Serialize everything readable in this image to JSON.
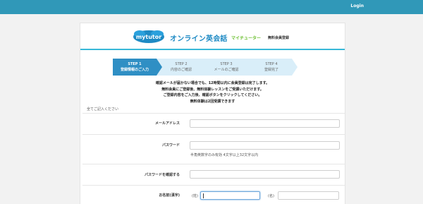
{
  "topbar": {
    "login_label": "Login",
    "bg_color": "#3098b8"
  },
  "header": {
    "logo_text": "mytutor",
    "brand_name": "オンライン英会話",
    "brand_sub": "マイチューター",
    "registration_label": "無料会員登録"
  },
  "steps": [
    {
      "num": "STEP 1",
      "label": "登録情報のご入力",
      "active": true
    },
    {
      "num": "STEP 2",
      "label": "内容のご確認",
      "active": false
    },
    {
      "num": "STEP 3",
      "label": "メールのご確認",
      "active": false
    },
    {
      "num": "STEP 4",
      "label": "登録完了",
      "active": false
    }
  ],
  "notice": [
    "確認メールが届かない場合でも、12時間以内に会員登録は完了します。",
    "無料会員にご登録後、無料体験レッスンをご受講いただけます。",
    "ご登録内容をご入力後、確認ボタンをクリックしてください。",
    "無料体験は2回受講できます"
  ],
  "form": {
    "section_title": "全てご記入ください",
    "email_label": "メールアドレス",
    "password_label": "パスワード",
    "password_hint": "半角英数字のみ有効 4文字以上32文字以内",
    "password_confirm_label": "パスワードを確認する",
    "name_label": "お名前(漢字)",
    "last_name_tag": "(姓)",
    "first_name_tag": "(名)"
  }
}
